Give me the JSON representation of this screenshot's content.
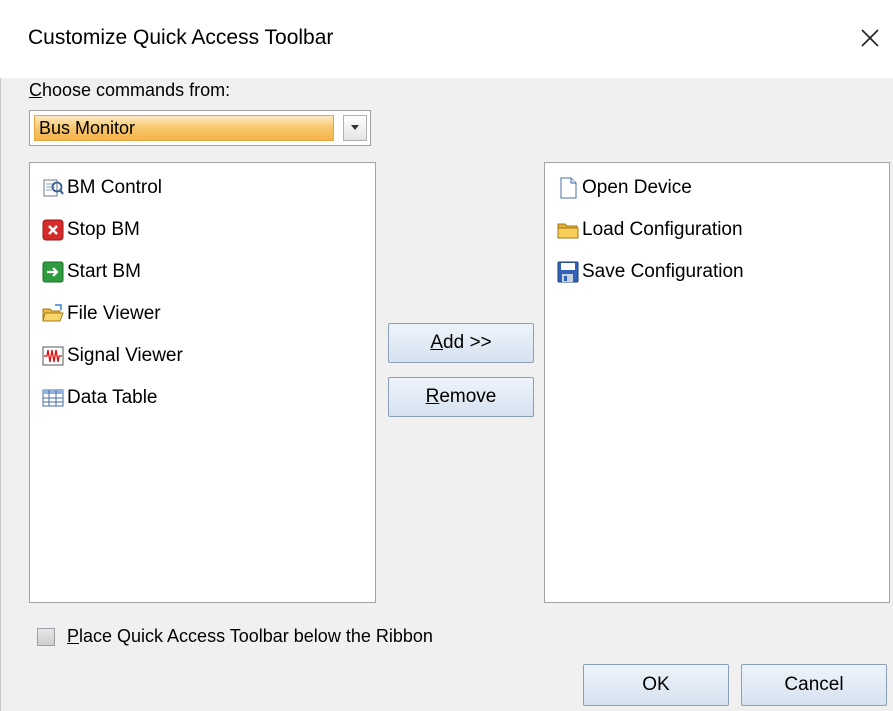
{
  "window": {
    "title": "Customize Quick Access Toolbar",
    "close_glyph": "✕"
  },
  "choose": {
    "label_underlined": "C",
    "label_rest": "hoose commands from:",
    "selected": "Bus Monitor"
  },
  "available_commands": [
    {
      "label": "BM Control",
      "icon": "bm-control-icon"
    },
    {
      "label": "Stop BM",
      "icon": "stop-icon"
    },
    {
      "label": "Start BM",
      "icon": "start-icon"
    },
    {
      "label": "File Viewer",
      "icon": "folder-open-icon"
    },
    {
      "label": "Signal Viewer",
      "icon": "signal-icon"
    },
    {
      "label": "Data Table",
      "icon": "table-icon"
    }
  ],
  "toolbar_commands": [
    {
      "label": "Open Device",
      "icon": "document-icon"
    },
    {
      "label": "Load Configuration",
      "icon": "folder-icon"
    },
    {
      "label": "Save Configuration",
      "icon": "save-icon"
    }
  ],
  "buttons": {
    "add_underlined": "A",
    "add_rest": "dd >>",
    "remove_underlined": "R",
    "remove_rest": "emove",
    "ok": "OK",
    "cancel": "Cancel"
  },
  "option": {
    "checked": false,
    "label_underlined": "P",
    "label_rest": "lace Quick Access Toolbar below the Ribbon"
  }
}
